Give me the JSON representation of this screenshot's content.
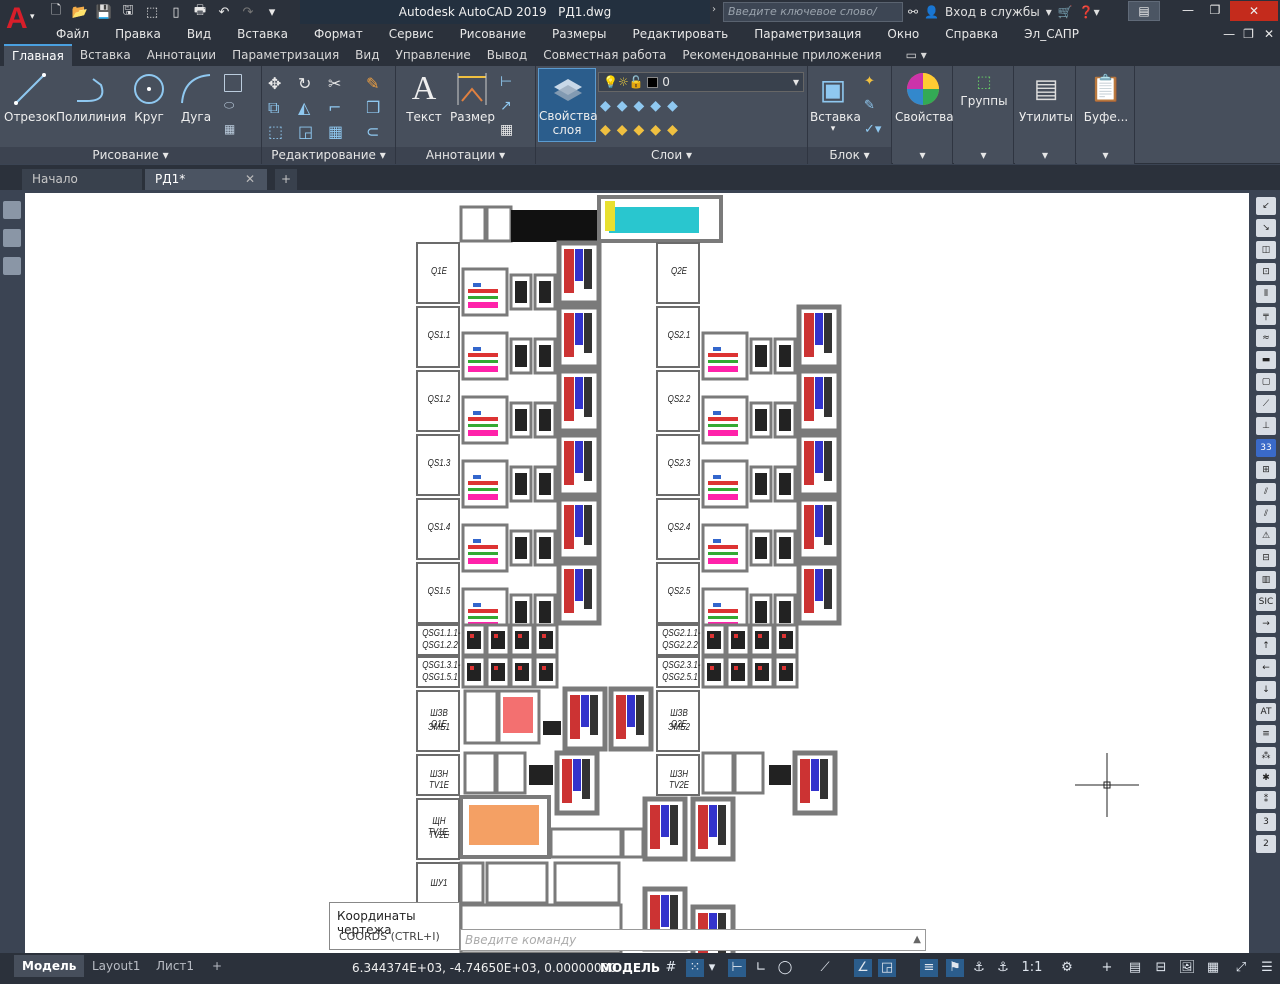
{
  "title": {
    "app": "Autodesk AutoCAD 2019",
    "file": "РД1.dwg"
  },
  "search": {
    "placeholder": "Введите ключевое слово/фразу"
  },
  "signin": {
    "label": "Вход в службы"
  },
  "menu": [
    "Файл",
    "Правка",
    "Вид",
    "Вставка",
    "Формат",
    "Сервис",
    "Рисование",
    "Размеры",
    "Редактировать",
    "Параметризация",
    "Окно",
    "Справка",
    "Эл_САПР"
  ],
  "ribbon_tabs": [
    "Главная",
    "Вставка",
    "Аннотации",
    "Параметризация",
    "Вид",
    "Управление",
    "Вывод",
    "Совместная работа",
    "Рекомендованные приложения"
  ],
  "ribbon": {
    "draw": {
      "line": "Отрезок",
      "polyline": "Полилиния",
      "circle": "Круг",
      "arc": "Дуга",
      "title": "Рисование"
    },
    "modify": {
      "title": "Редактирование"
    },
    "annotation": {
      "text": "Текст",
      "dimension": "Размер",
      "title": "Аннотации"
    },
    "layers": {
      "props_line1": "Свойства",
      "props_line2": "слоя",
      "current_layer": "0",
      "title": "Слои"
    },
    "block": {
      "insert": "Вставка",
      "title": "Блок"
    },
    "properties": {
      "label": "Свойства"
    },
    "groups": {
      "label": "Группы"
    },
    "utilities": {
      "label": "Утилиты"
    },
    "clipboard": {
      "label": "Буфе..."
    }
  },
  "doc_tabs": {
    "start": "Начало",
    "current": "РД1*"
  },
  "drawing_labels": {
    "left": [
      "Q1E",
      "QS1.1",
      "QS1.2",
      "QS1.3",
      "QS1.4",
      "QS1.5"
    ],
    "left_small": [
      [
        "QSG1.1.1-",
        "QSG1.2.2"
      ],
      [
        "QSG1.3.1-",
        "QSG1.5.1"
      ]
    ],
    "right": [
      "Q2E",
      "QS2.1",
      "QS2.2",
      "QS2.3",
      "QS2.4",
      "QS2.5"
    ],
    "right_small": [
      [
        "QSG2.1.1-",
        "QSG2.2.2"
      ],
      [
        "QSG2.3.1-",
        "QSG2.5.1"
      ]
    ],
    "shzv": [
      [
        "ШЗВ Q1E",
        "ЭМБ1"
      ],
      [
        "ШЗВ Q2E",
        "ЭМБ2"
      ]
    ],
    "shzn": [
      "ШЗН TV1E",
      "ШЗН TV2E"
    ],
    "shchn": [
      "ЩН TV1E,",
      "TV2E"
    ],
    "shu": "ШУ1"
  },
  "tooltip": {
    "title": "Координаты чертежа",
    "shortcut": "COORDS (CTRL+I)"
  },
  "command": {
    "placeholder": "Введите команду"
  },
  "layout_tabs": [
    "Модель",
    "Layout1",
    "Лист1"
  ],
  "status": {
    "coords": "6.344374E+03, -4.74650E+03, 0.00000000",
    "space": "МОДЕЛЬ",
    "scale": "1:1"
  },
  "colors": {
    "accent": "#2b5d8c",
    "app_red": "#d81e2a"
  }
}
